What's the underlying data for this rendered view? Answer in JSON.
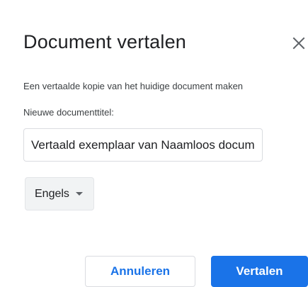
{
  "dialog": {
    "title": "Document vertalen",
    "description": "Een vertaalde kopie van het huidige document maken",
    "field_label": "Nieuwe documenttitel:",
    "title_input_value": "Vertaald exemplaar van Naamloos document",
    "language": "Engels",
    "cancel_label": "Annuleren",
    "translate_label": "Vertalen"
  },
  "icons": {
    "close": "close-icon",
    "dropdown": "caret-down-icon"
  },
  "colors": {
    "accent": "#1a73e8",
    "text": "#202124",
    "secondary_text": "#3c4043",
    "border": "#dadce0",
    "select_bg": "#f1f3f4"
  }
}
